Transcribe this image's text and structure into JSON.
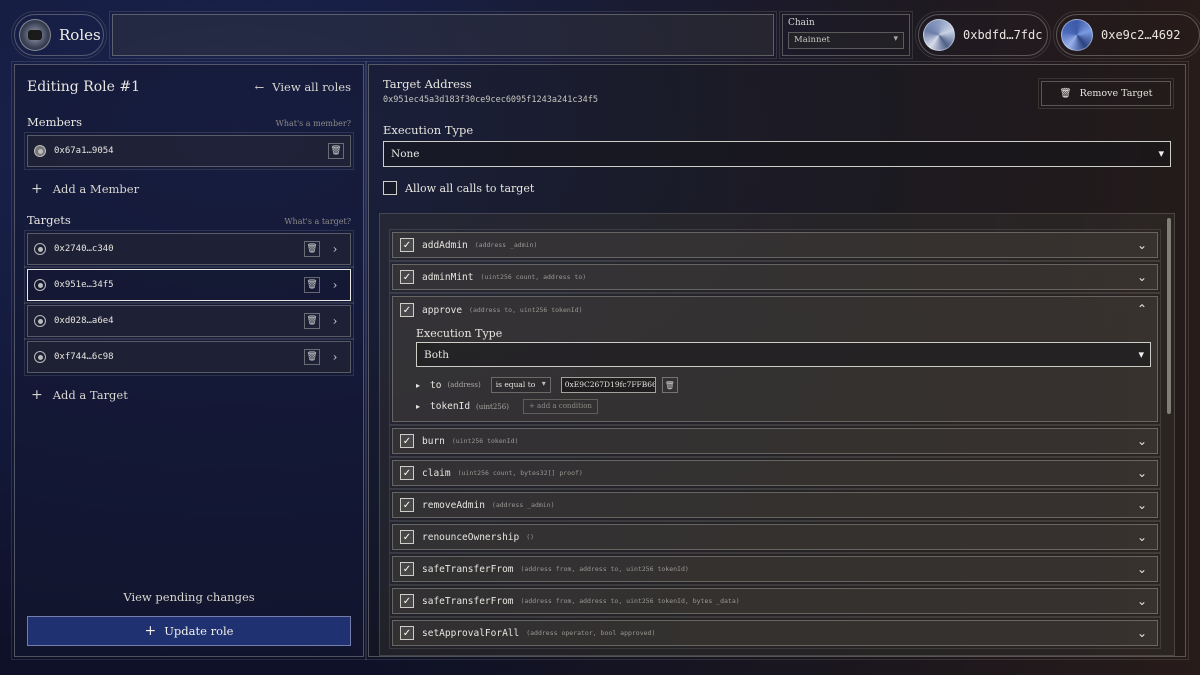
{
  "header": {
    "app_title": "Roles",
    "chain_label": "Chain",
    "chain_value": "Mainnet",
    "accounts": [
      "0xbdfd…7fdc",
      "0xe9c2…4692"
    ]
  },
  "left": {
    "title": "Editing Role #1",
    "view_all": "View all roles",
    "members_label": "Members",
    "members_help": "What's a member?",
    "members": [
      "0x67a1…9054"
    ],
    "add_member": "Add a Member",
    "targets_label": "Targets",
    "targets_help": "What's a target?",
    "targets": [
      "0x2740…c340",
      "0x951e…34f5",
      "0xd028…a6e4",
      "0xf744…6c98"
    ],
    "add_target": "Add a Target",
    "pending": "View pending changes",
    "update": "Update role"
  },
  "right": {
    "target_label": "Target Address",
    "target_value": "0x951ec45a3d183f30ce9cec6095f1243a241c34f5",
    "remove_label": "Remove Target",
    "exec_label": "Execution Type",
    "exec_value": "None",
    "allow_label": "Allow all calls to target",
    "functions": [
      {
        "name": "addAdmin",
        "args": "(address _admin)"
      },
      {
        "name": "adminMint",
        "args": "(uint256 count, address to)"
      },
      {
        "name": "approve",
        "args": "(address to, uint256 tokenId)"
      },
      {
        "name": "burn",
        "args": "(uint256 tokenId)"
      },
      {
        "name": "claim",
        "args": "(uint256 count, bytes32[] proof)"
      },
      {
        "name": "removeAdmin",
        "args": "(address _admin)"
      },
      {
        "name": "renounceOwnership",
        "args": "()"
      },
      {
        "name": "safeTransferFrom",
        "args": "(address from, address to, uint256 tokenId)"
      },
      {
        "name": "safeTransferFrom",
        "args": "(address from, address to, uint256 tokenId, bytes _data)"
      },
      {
        "name": "setApprovalForAll",
        "args": "(address operator, bool approved)"
      }
    ],
    "approve_detail": {
      "exec_label": "Execution Type",
      "exec_value": "Both",
      "param1_name": "to",
      "param1_type": "(address)",
      "param1_cond": "is equal to",
      "param1_value": "0xE9C267D19fc7FFB66",
      "param2_name": "tokenId",
      "param2_type": "(uint256)",
      "param2_add": "+ add a condition"
    }
  }
}
